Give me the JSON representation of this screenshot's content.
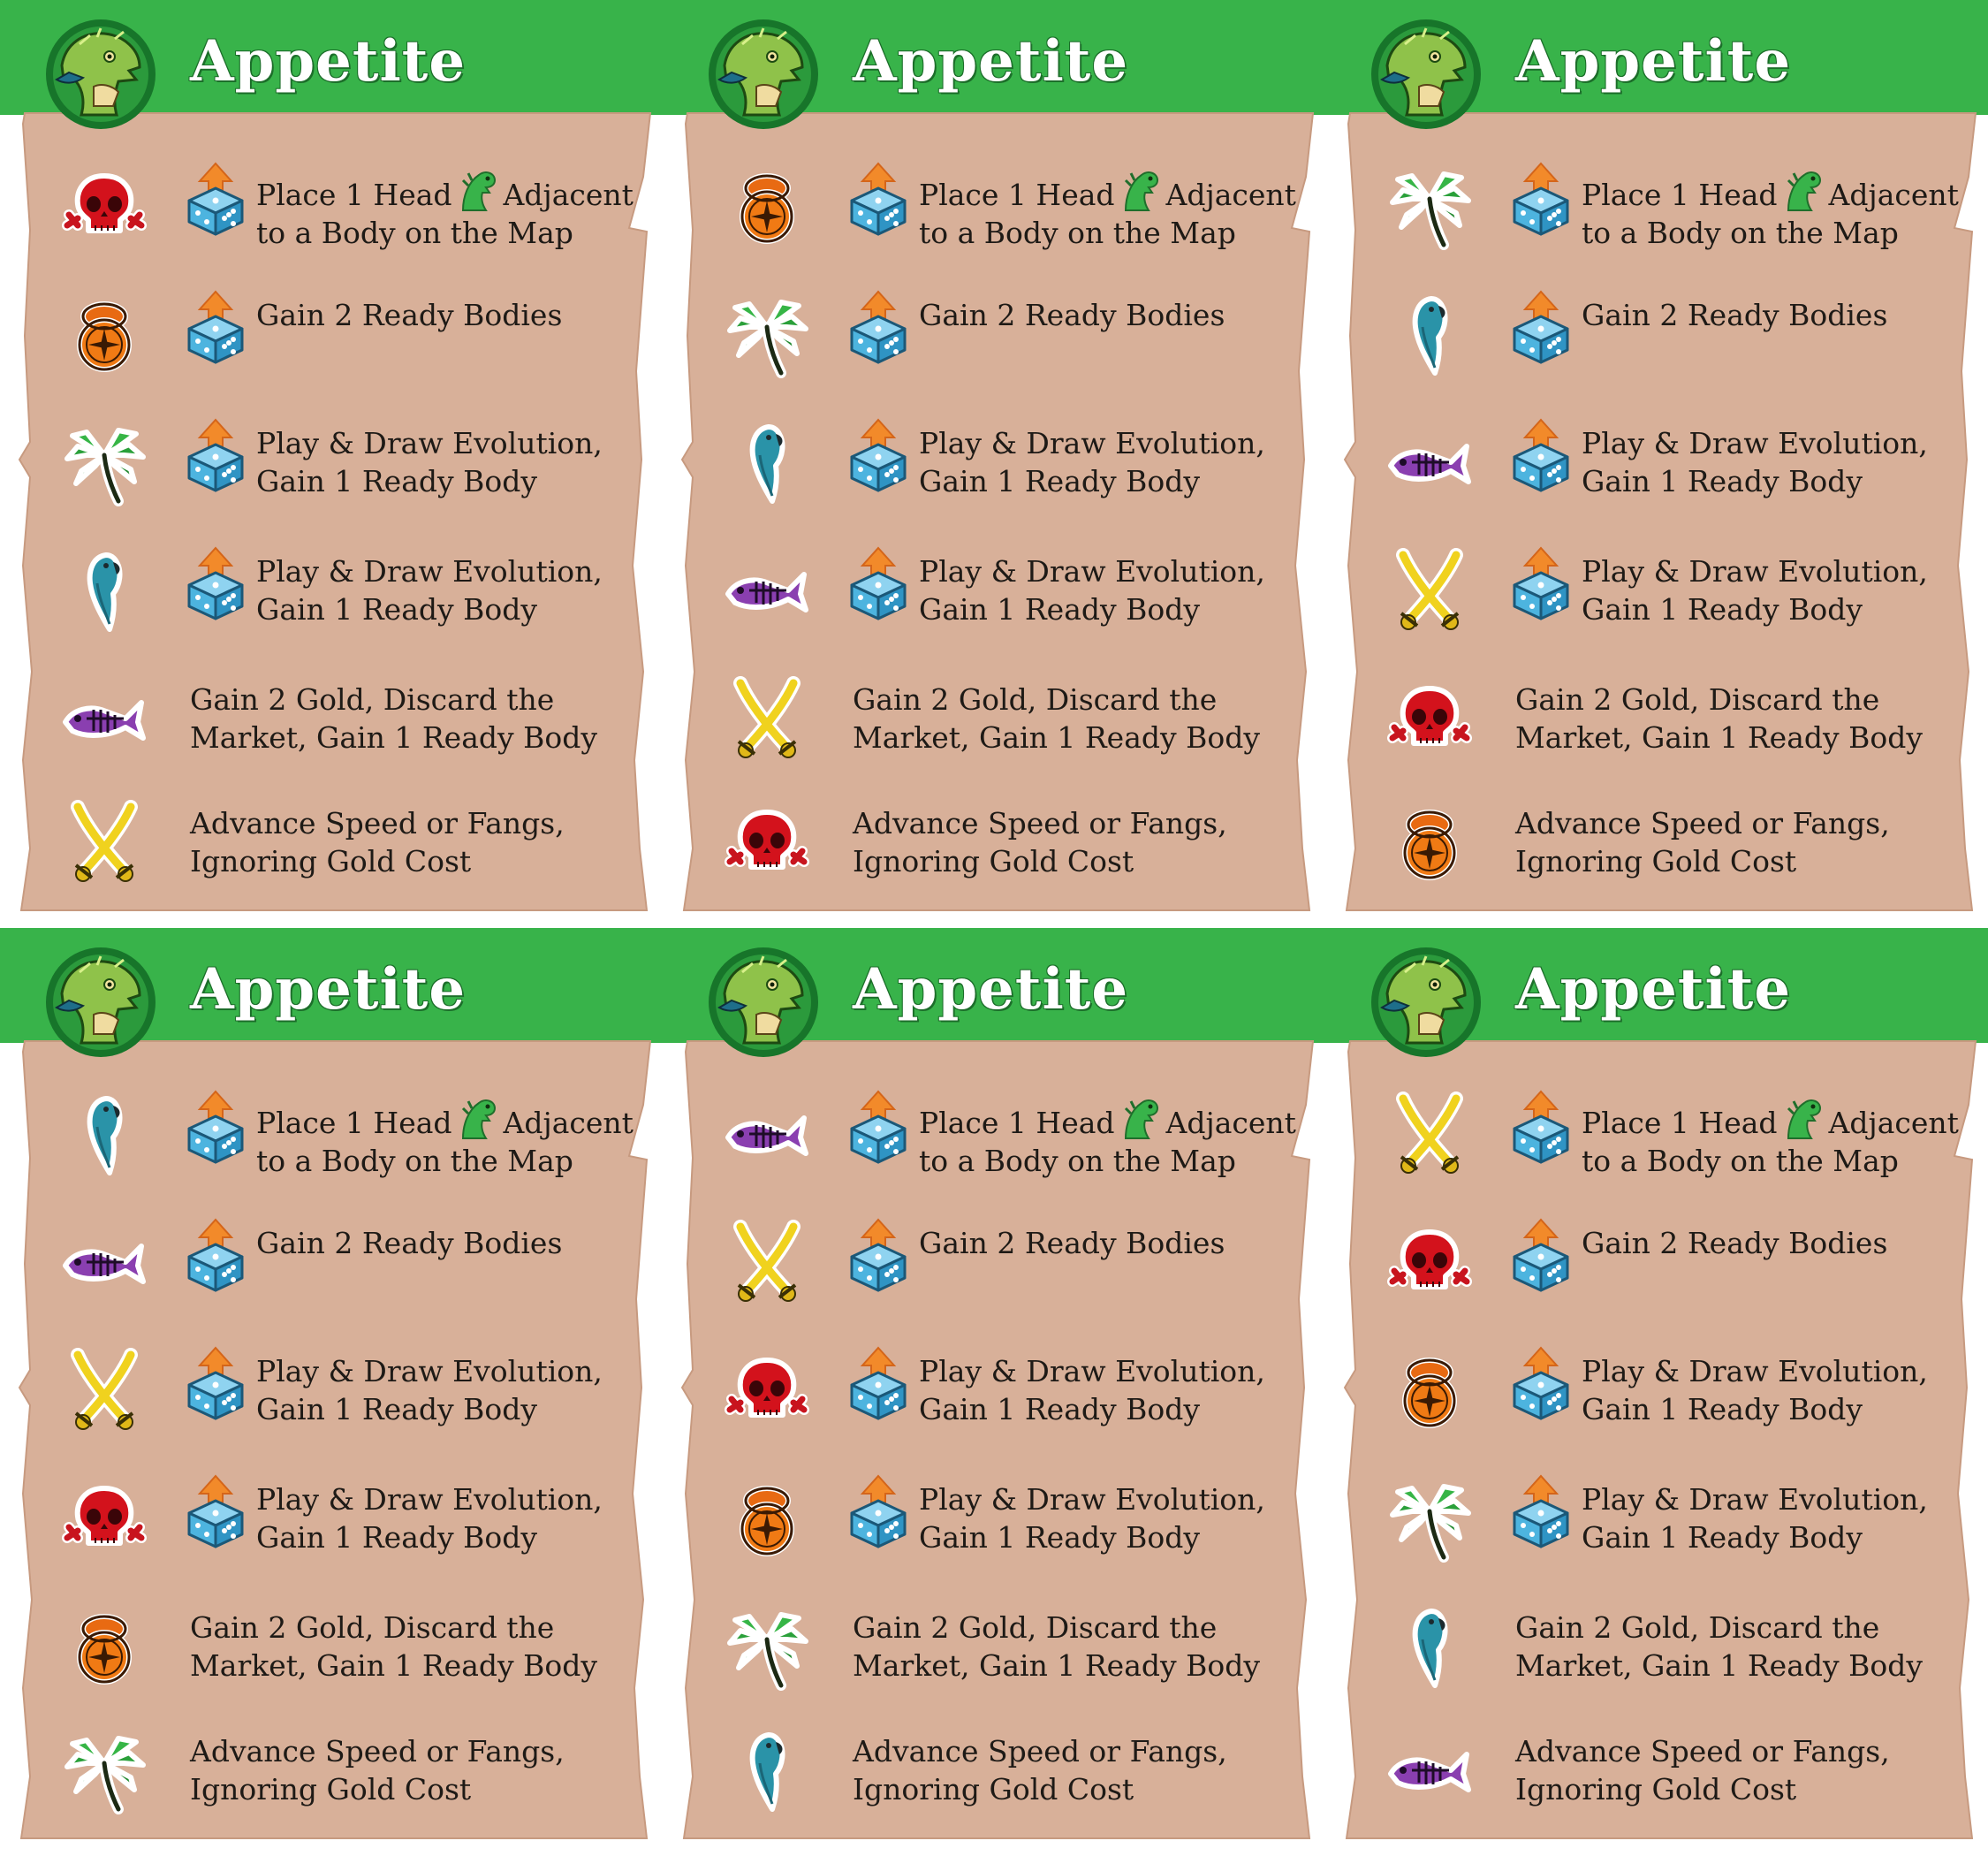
{
  "cards": [
    {
      "title": "Appetite",
      "icons": [
        "skull",
        "compass",
        "palm",
        "parrot",
        "fish",
        "swords"
      ]
    },
    {
      "title": "Appetite",
      "icons": [
        "compass",
        "palm",
        "parrot",
        "fish",
        "swords",
        "skull"
      ]
    },
    {
      "title": "Appetite",
      "icons": [
        "palm",
        "parrot",
        "fish",
        "swords",
        "skull",
        "compass"
      ]
    },
    {
      "title": "Appetite",
      "icons": [
        "parrot",
        "fish",
        "swords",
        "skull",
        "compass",
        "palm"
      ]
    },
    {
      "title": "Appetite",
      "icons": [
        "fish",
        "swords",
        "skull",
        "compass",
        "palm",
        "parrot"
      ]
    },
    {
      "title": "Appetite",
      "icons": [
        "swords",
        "skull",
        "compass",
        "palm",
        "parrot",
        "fish"
      ]
    }
  ],
  "abilities": [
    {
      "has_die": true,
      "lines": [
        "Place 1 Head",
        "Adjacent",
        "to a Body on the Map"
      ],
      "inline_icon": "dinosaur-head-icon"
    },
    {
      "has_die": true,
      "lines": [
        "Gain 2 Ready Bodies"
      ]
    },
    {
      "has_die": true,
      "lines": [
        "Play & Draw Evolution,",
        "Gain 1 Ready Body"
      ]
    },
    {
      "has_die": true,
      "lines": [
        "Play & Draw Evolution,",
        "Gain 1 Ready Body"
      ]
    },
    {
      "has_die": false,
      "lines": [
        "Gain 2 Gold, Discard the",
        "Market, Gain 1 Ready Body"
      ]
    },
    {
      "has_die": false,
      "lines": [
        "Advance Speed or Fangs,",
        "Ignoring Gold Cost"
      ]
    }
  ],
  "icon_legend": {
    "skull": "skull-icon",
    "compass": "compass-icon",
    "palm": "palm-tree-icon",
    "parrot": "parrot-icon",
    "fish": "fish-skeleton-icon",
    "swords": "crossed-swords-icon"
  },
  "colors": {
    "banner_green": "#38b34a",
    "parchment": "#d8b099",
    "text": "#1e1a16"
  }
}
